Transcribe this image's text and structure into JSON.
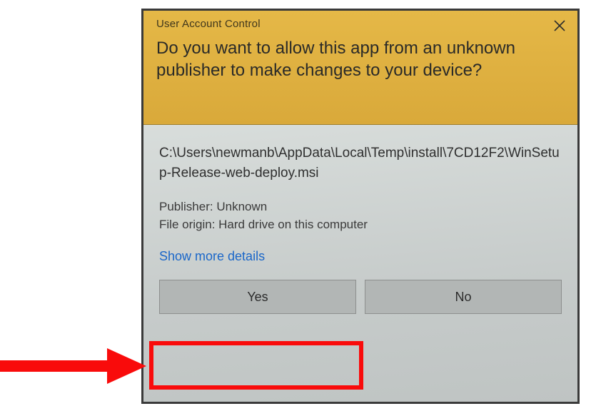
{
  "dialog": {
    "title_small": "User Account Control",
    "prompt": "Do you want to allow this app from an unknown publisher to make changes to your device?",
    "file_path": "C:\\Users\\newmanb\\AppData\\Local\\Temp\\install\\7CD12F2\\WinSetup-Release-web-deploy.msi",
    "publisher_label": "Publisher:",
    "publisher_value": "Unknown",
    "origin_label": "File origin:",
    "origin_value": "Hard drive on this computer",
    "details_link": "Show more details",
    "yes_label": "Yes",
    "no_label": "No"
  },
  "annotation": {
    "highlight_color": "#f90b0b",
    "arrow_color": "#f90b0b"
  }
}
